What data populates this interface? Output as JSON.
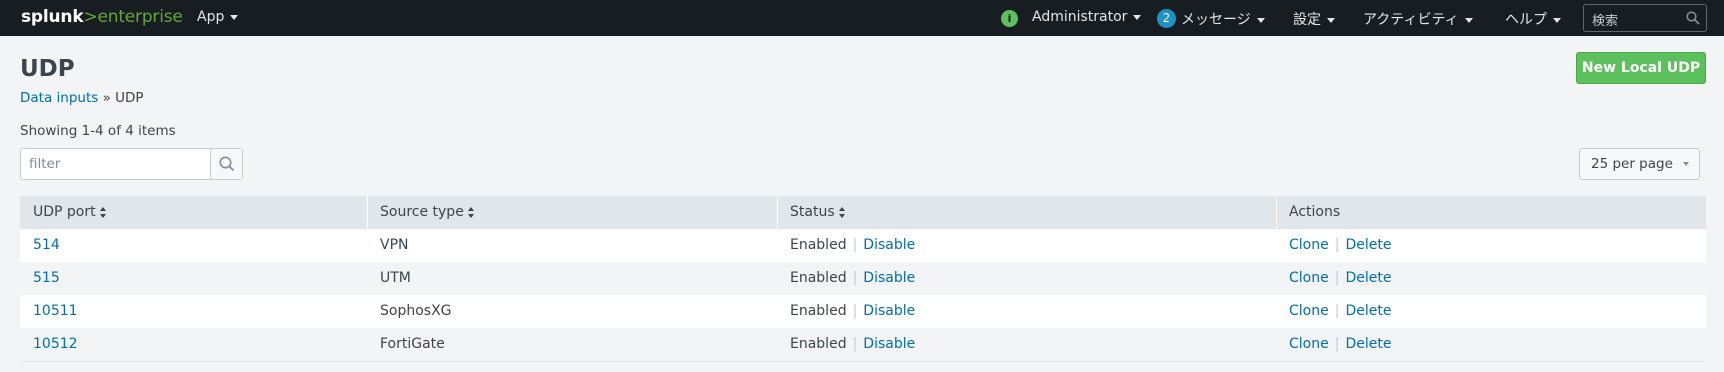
{
  "topbar": {
    "logo_part1": "splunk",
    "logo_part2": ">enterprise",
    "app_label": "App",
    "admin_label": "Administrator",
    "messages_count": "2",
    "messages_label": "メッセージ",
    "settings_label": "設定",
    "activity_label": "アクティビティ",
    "help_label": "ヘルプ",
    "search_placeholder": "検索"
  },
  "header": {
    "title": "UDP",
    "breadcrumb_link": "Data inputs",
    "breadcrumb_sep": " » ",
    "breadcrumb_current": "UDP",
    "new_button": "New Local UDP"
  },
  "list": {
    "showing": "Showing 1-4 of 4 items",
    "filter_placeholder": "filter",
    "per_page": "25 per page"
  },
  "table": {
    "columns": [
      "UDP port",
      "Source type",
      "Status",
      "Actions"
    ],
    "rows": [
      {
        "port": "514",
        "source": "VPN",
        "status": "Enabled",
        "toggle": "Disable",
        "clone": "Clone",
        "delete": "Delete"
      },
      {
        "port": "515",
        "source": "UTM",
        "status": "Enabled",
        "toggle": "Disable",
        "clone": "Clone",
        "delete": "Delete"
      },
      {
        "port": "10511",
        "source": "SophosXG",
        "status": "Enabled",
        "toggle": "Disable",
        "clone": "Clone",
        "delete": "Delete"
      },
      {
        "port": "10512",
        "source": "FortiGate",
        "status": "Enabled",
        "toggle": "Disable",
        "clone": "Clone",
        "delete": "Delete"
      }
    ]
  },
  "colors": {
    "topbar_bg": "#171d21",
    "brand_green": "#65a637",
    "button_green": "#5cc05c",
    "link_blue": "#006eaa",
    "badge_blue": "#1e93c6"
  }
}
